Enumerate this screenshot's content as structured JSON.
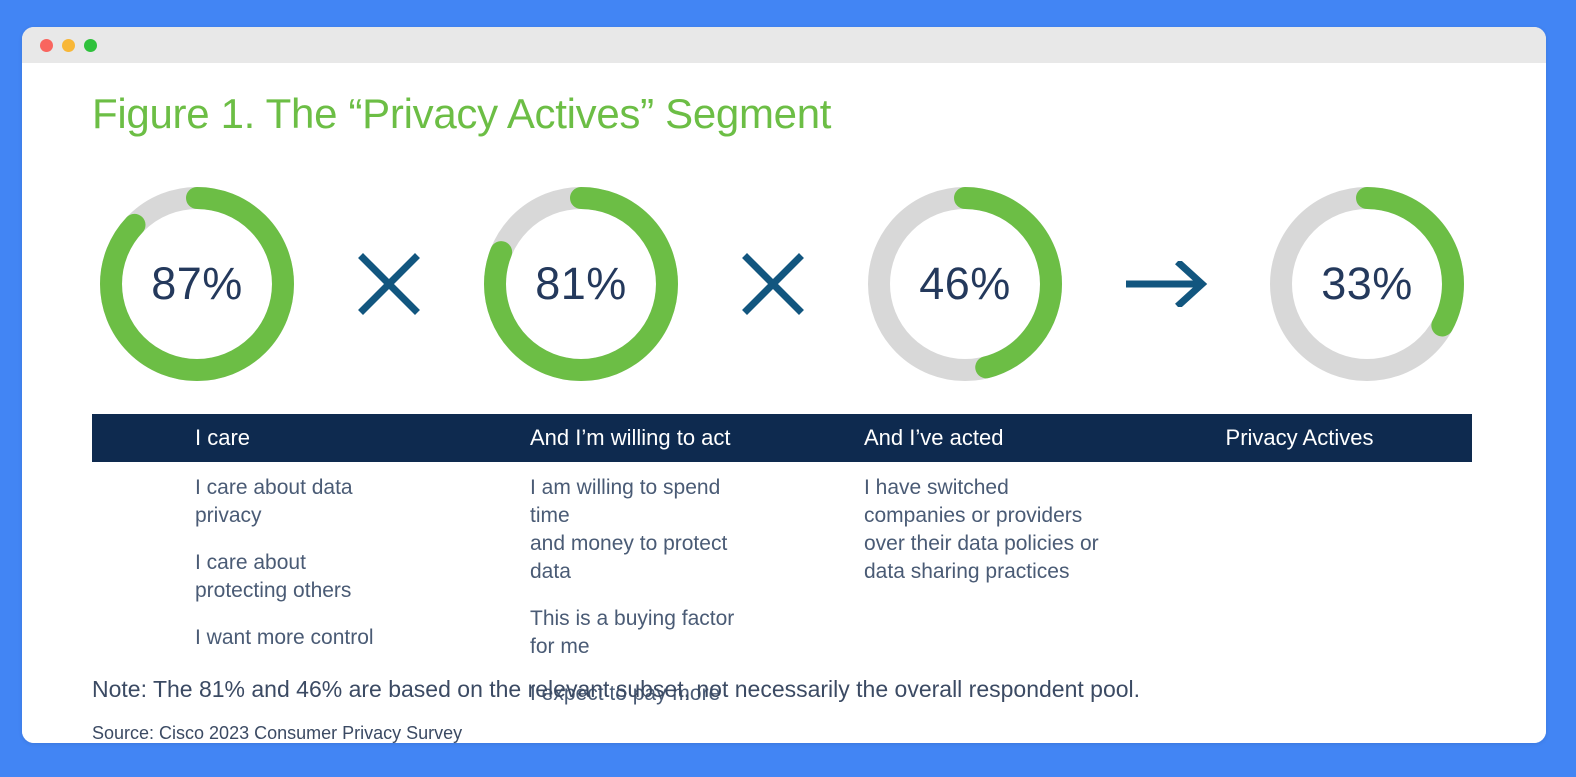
{
  "window": {
    "background_color": "#4285f4",
    "titlebar_color": "#e8e8e8",
    "traffic_lights": [
      {
        "name": "close",
        "color": "#f9655f"
      },
      {
        "name": "minimize",
        "color": "#f8b738"
      },
      {
        "name": "maximize",
        "color": "#2fc13c"
      }
    ]
  },
  "figure": {
    "title": "Figure 1. The “Privacy Actives” Segment",
    "title_color": "#6cbe45",
    "note": "Note: The 81% and 46% are based on the relevant subset, not necessarily the overall respondent pool.",
    "source": "Source: Cisco 2023 Consumer Privacy Survey"
  },
  "colors": {
    "green": "#6cbe45",
    "track_gray": "#d8d8d8",
    "navy": "#0e2a4f",
    "value_text": "#24395c",
    "body_text": "#4a5b75",
    "operator": "#12567f"
  },
  "operators": [
    {
      "name": "multiply",
      "glyph": "×"
    },
    {
      "name": "multiply",
      "glyph": "×"
    },
    {
      "name": "arrow-right",
      "glyph": "→"
    }
  ],
  "columns": [
    {
      "header": "I care",
      "value_label": "87%",
      "items": [
        "I care about data privacy",
        "I care about\nprotecting others",
        "I want more control"
      ]
    },
    {
      "header": "And I’m willing to act",
      "value_label": "81%",
      "items": [
        "I am willing to spend time\nand money to protect data",
        "This is a buying factor for me",
        "I expect to pay more"
      ]
    },
    {
      "header": "And I’ve acted",
      "value_label": "46%",
      "items": [
        "I have switched\ncompanies or providers\nover their data policies or\ndata sharing practices"
      ]
    },
    {
      "header": "Privacy Actives",
      "value_label": "33%",
      "items": []
    }
  ],
  "chart_data": {
    "type": "pie",
    "title": "Figure 1. The “Privacy Actives” Segment",
    "subtype": "donut-gauge-series",
    "categories": [
      "I care",
      "And I’m willing to act",
      "And I’ve acted",
      "Privacy Actives"
    ],
    "values": [
      87,
      81,
      46,
      33
    ],
    "value_labels": [
      "87%",
      "81%",
      "46%",
      "33%"
    ],
    "unit": "percent",
    "ylim": [
      0,
      100
    ],
    "grid": false,
    "legend": "none",
    "filled_color": "#6cbe45",
    "remainder_color": "#d8d8d8",
    "start_angle_deg": 0,
    "direction": "clockwise",
    "relation": "87% × 81% × 46% → 33%",
    "annotations": [
      "Note: The 81% and 46% are based on the relevant subset, not necessarily the overall respondent pool.",
      "Source: Cisco 2023 Consumer Privacy Survey"
    ]
  }
}
